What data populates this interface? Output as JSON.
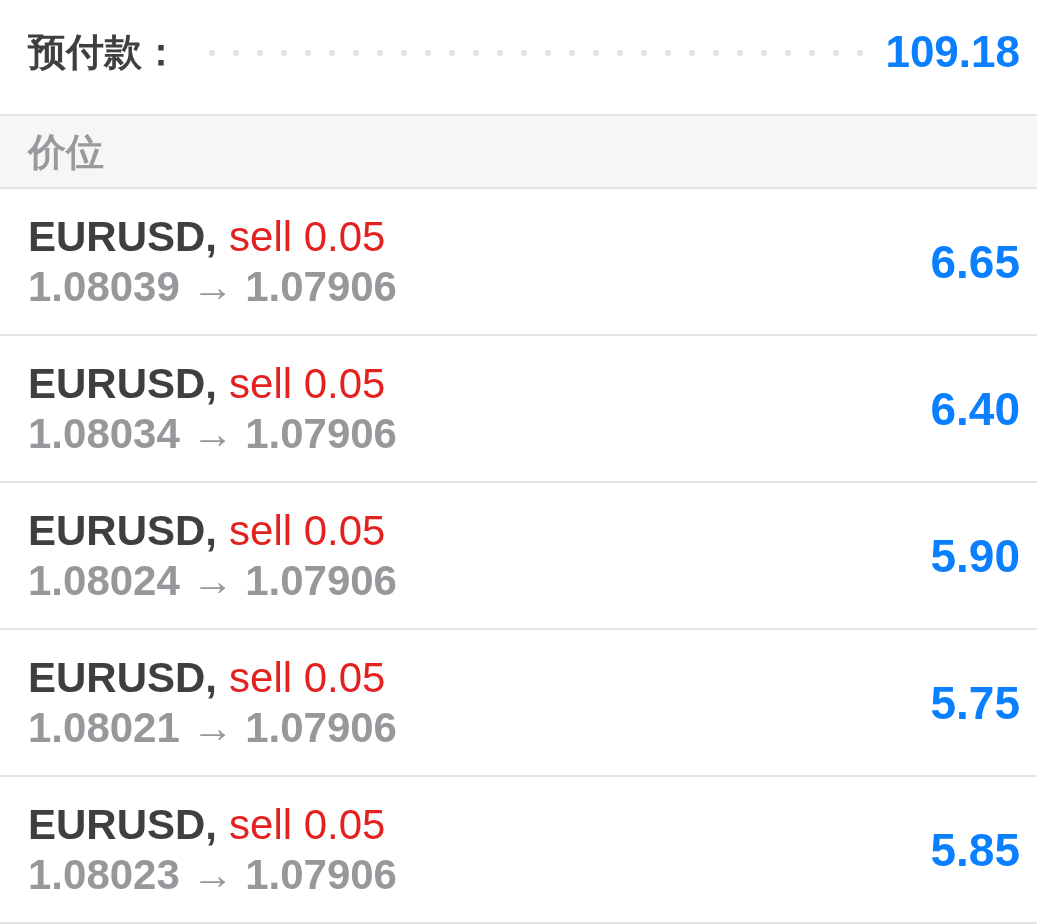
{
  "summary": {
    "label": "预付款：",
    "value": "109.18"
  },
  "section": {
    "title": "价位"
  },
  "positions": [
    {
      "symbol": "EURUSD,",
      "order": "sell 0.05",
      "prices": "1.08039 → 1.07906",
      "profit": "6.65"
    },
    {
      "symbol": "EURUSD,",
      "order": "sell 0.05",
      "prices": "1.08034 → 1.07906",
      "profit": "6.40"
    },
    {
      "symbol": "EURUSD,",
      "order": "sell 0.05",
      "prices": "1.08024 → 1.07906",
      "profit": "5.90"
    },
    {
      "symbol": "EURUSD,",
      "order": "sell 0.05",
      "prices": "1.08021 → 1.07906",
      "profit": "5.75"
    },
    {
      "symbol": "EURUSD,",
      "order": "sell 0.05",
      "prices": "1.08023 → 1.07906",
      "profit": "5.85"
    }
  ]
}
